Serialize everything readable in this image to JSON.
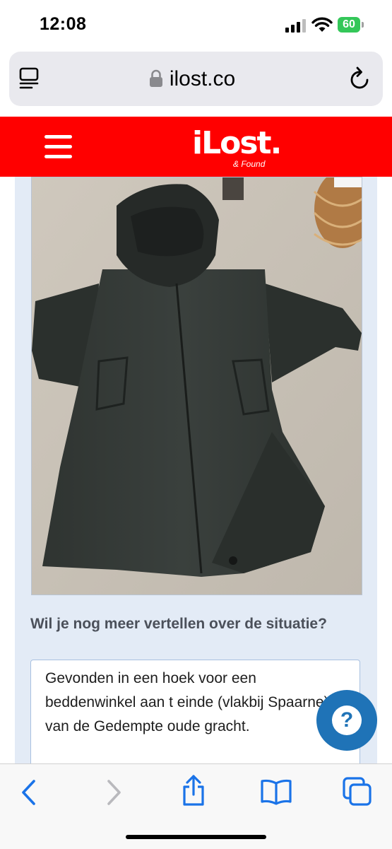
{
  "status_bar": {
    "time": "12:08",
    "battery": "60"
  },
  "browser": {
    "url": "ilost.co"
  },
  "site": {
    "logo": "iLost.",
    "tagline": "& Found"
  },
  "form": {
    "question": "Wil je nog meer vertellen over de situatie?",
    "answer": "Gevonden in een  hoek voor een beddenwinkel aan t einde (vlakbij Spaarne) van de Gedempte oude gracht."
  },
  "help_button": {
    "label": "?"
  },
  "colors": {
    "brand_red": "#ff0000",
    "help_blue": "#1f73b7",
    "ios_blue": "#1a73e8"
  },
  "icons": [
    "reader-icon",
    "lock-icon",
    "reload-icon",
    "menu-icon",
    "back-icon",
    "forward-icon",
    "share-icon",
    "bookmarks-icon",
    "tabs-icon"
  ]
}
